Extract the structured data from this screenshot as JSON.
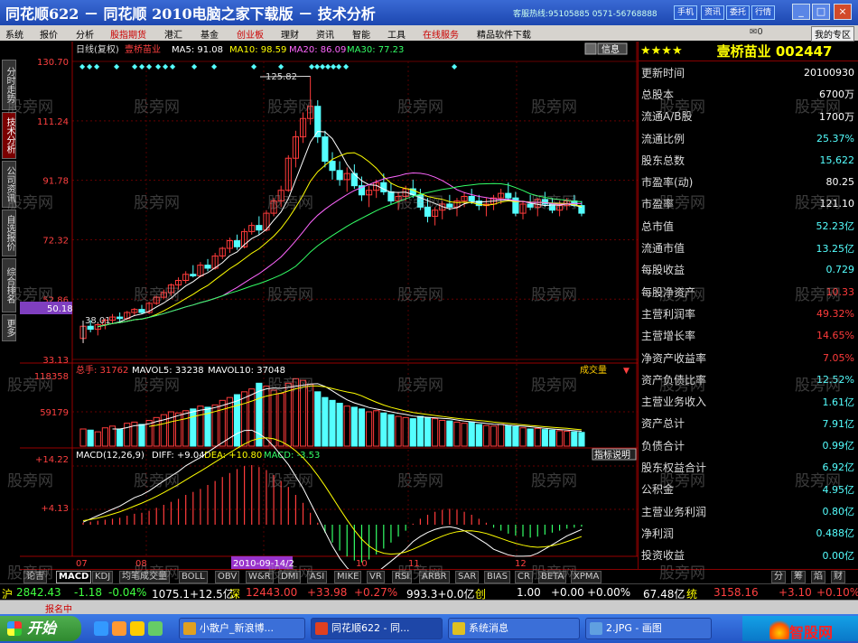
{
  "window": {
    "title": "同花顺622 － 同花顺 2010电脑之家下载版 － 技术分析",
    "hotline": "客服热线:95105885 0571-56768888",
    "title_buttons": [
      "手机",
      "资讯",
      "委托",
      "行情"
    ],
    "mail_count": "0"
  },
  "menu": {
    "items": [
      "系统",
      "报价",
      "分析",
      "股指期货",
      "港汇",
      "基金",
      "创业板",
      "理财",
      "资讯",
      "智能",
      "工具",
      "在线服务",
      "精品软件下载"
    ],
    "highlighted": [
      "股指期货",
      "创业板",
      "在线服务"
    ],
    "my_zone": "我的专区"
  },
  "left_tabs": [
    "分时走势",
    "技术分析",
    "公司资讯",
    "自选报价",
    "综合排名",
    "更多"
  ],
  "chart_header": {
    "period": "日线(复权)",
    "stock_name": "壹桥苗业",
    "ma5": "MA5: 91.08",
    "ma10": "MA10: 98.59",
    "ma20": "MA20: 86.09",
    "ma30": "MA30: 77.23",
    "info_button": "信息",
    "info_icon": "dual-arrow"
  },
  "volume_header": {
    "total": "总手: 31762",
    "mavol5": "MAVOL5: 33238",
    "mavol10": "MAVOL10: 37048",
    "selector": "成交量"
  },
  "macd_header": {
    "title": "MACD(12,26,9)",
    "diff": "DIFF: +9.04",
    "dea": "DEA: +10.80",
    "macd": "MACD: -3.53",
    "help": "指标说明"
  },
  "y_axis": {
    "price_ticks": [
      "130.70",
      "111.24",
      "91.78",
      "72.32",
      "52.86",
      "33.13"
    ],
    "current_price_box": "50.18",
    "volume_ticks": [
      "118358",
      "59179"
    ],
    "macd_ticks": [
      "+14.22",
      "+4.13"
    ]
  },
  "x_axis": {
    "labels": [
      "07",
      "08",
      "10",
      "11",
      "12"
    ],
    "cursor_date": "2010-09-14/2"
  },
  "chart_data": {
    "type": "candlestick",
    "annotations": {
      "high_label": "125.82",
      "low_label": "38.01"
    },
    "price_range": [
      33.13,
      130.7
    ],
    "candles": [
      [
        40,
        45,
        38.5,
        44
      ],
      [
        44,
        46,
        42,
        43
      ],
      [
        43,
        45,
        41,
        44.5
      ],
      [
        44.5,
        46.5,
        43,
        46
      ],
      [
        46,
        48,
        45,
        47
      ],
      [
        47,
        48.5,
        45.5,
        46.5
      ],
      [
        46.5,
        49,
        46,
        48.5
      ],
      [
        48.5,
        50,
        47.5,
        49.5
      ],
      [
        49.5,
        51,
        48,
        48.5
      ],
      [
        48.5,
        52,
        48,
        51.5
      ],
      [
        51.5,
        54,
        51,
        53.5
      ],
      [
        53.5,
        56,
        53,
        55
      ],
      [
        55,
        58,
        54,
        57.5
      ],
      [
        57.5,
        60,
        56,
        59
      ],
      [
        59,
        62,
        58,
        61
      ],
      [
        61,
        64,
        60,
        60.5
      ],
      [
        60.5,
        65,
        60,
        64
      ],
      [
        64,
        66,
        62,
        63
      ],
      [
        63,
        68,
        62.5,
        67
      ],
      [
        67,
        70,
        66,
        69.5
      ],
      [
        69.5,
        73,
        68,
        72
      ],
      [
        72,
        74,
        69,
        70
      ],
      [
        70,
        76,
        69.5,
        75
      ],
      [
        75,
        78,
        74,
        77
      ],
      [
        77,
        80,
        74,
        75.5
      ],
      [
        75.5,
        82,
        75,
        81
      ],
      [
        81,
        86,
        80,
        85
      ],
      [
        85,
        90,
        83,
        88.5
      ],
      [
        88.5,
        100,
        88,
        99
      ],
      [
        99,
        108,
        96,
        106
      ],
      [
        106,
        114,
        104,
        112
      ],
      [
        112,
        125.82,
        110,
        116
      ],
      [
        116,
        118,
        104,
        106
      ],
      [
        106,
        108,
        96,
        98
      ],
      [
        98,
        101,
        92,
        95
      ],
      [
        95,
        98,
        90,
        92
      ],
      [
        92,
        96,
        88,
        94
      ],
      [
        94,
        97,
        89,
        90
      ],
      [
        90,
        93,
        85,
        87
      ],
      [
        87,
        90,
        83,
        88.5
      ],
      [
        88.5,
        92,
        86,
        91
      ],
      [
        91,
        94,
        87,
        88
      ],
      [
        88,
        91,
        84,
        85
      ],
      [
        85,
        88,
        82,
        86.5
      ],
      [
        86.5,
        90,
        85,
        89
      ],
      [
        89,
        92,
        86,
        87
      ],
      [
        87,
        89,
        82,
        83
      ],
      [
        83,
        86,
        78,
        80
      ],
      [
        80,
        83,
        77,
        82
      ],
      [
        82,
        85,
        79,
        84
      ],
      [
        84,
        87,
        82,
        83
      ],
      [
        83,
        86,
        80,
        85
      ],
      [
        85,
        88,
        83,
        86.5
      ],
      [
        86.5,
        89,
        84,
        85
      ],
      [
        85,
        87,
        82,
        83.5
      ],
      [
        83.5,
        86,
        80,
        84
      ],
      [
        84,
        87,
        82,
        86
      ],
      [
        86,
        89,
        84,
        87.5
      ],
      [
        87.5,
        91,
        85,
        86
      ],
      [
        86,
        88,
        80,
        81
      ],
      [
        81,
        85,
        79,
        84
      ],
      [
        84,
        87,
        82,
        83
      ],
      [
        83,
        86,
        80,
        85.5
      ],
      [
        85.5,
        88,
        83,
        84
      ],
      [
        84,
        86,
        81,
        82
      ],
      [
        82,
        85,
        80,
        83.5
      ],
      [
        83.5,
        86,
        82,
        85
      ],
      [
        85,
        87,
        83,
        83.5
      ],
      [
        83.5,
        85,
        80,
        81
      ]
    ],
    "volumes": [
      30,
      28,
      25,
      32,
      35,
      30,
      40,
      42,
      38,
      45,
      50,
      55,
      60,
      58,
      62,
      65,
      70,
      68,
      72,
      80,
      85,
      90,
      95,
      100,
      110,
      105,
      98,
      92,
      110,
      118,
      115,
      108,
      95,
      85,
      80,
      75,
      70,
      68,
      65,
      60,
      62,
      58,
      55,
      52,
      50,
      48,
      52,
      50,
      48,
      45,
      44,
      42,
      40,
      42,
      38,
      36,
      35,
      38,
      36,
      34,
      32,
      30,
      31,
      29,
      28,
      27,
      26,
      25,
      24
    ],
    "ma_series": [
      {
        "name": "MA5",
        "color": "#ffffff"
      },
      {
        "name": "MA10",
        "color": "#ffff00"
      },
      {
        "name": "MA20",
        "color": "#ff66ff"
      },
      {
        "name": "MA30",
        "color": "#33ff66"
      }
    ],
    "macd_histogram": [
      0.2,
      0.3,
      0.4,
      0.5,
      0.6,
      0.7,
      0.9,
      1.1,
      1.2,
      1.4,
      1.7,
      2.0,
      2.3,
      2.6,
      3.0,
      3.3,
      3.6,
      4.0,
      4.4,
      4.8,
      5.2,
      5.6,
      5.9,
      6.0,
      5.8,
      5.5,
      5.0,
      4.4,
      3.8,
      3.0,
      2.2,
      1.2,
      0.2,
      -0.8,
      -1.8,
      -2.6,
      -3.2,
      -3.6,
      -3.8,
      -3.5,
      -3.0,
      -2.4,
      -1.8,
      -1.2,
      -0.6,
      0.1,
      0.6,
      1.0,
      1.3,
      1.5,
      1.6,
      1.5,
      1.3,
      1.0,
      0.6,
      0.2,
      -0.3,
      -0.6,
      -0.9,
      -1.1,
      -1.2,
      -1.3,
      -1.2,
      -1.0,
      -0.8,
      -0.6,
      -0.4,
      -0.3,
      -0.2
    ]
  },
  "fundamentals": {
    "stars": "★★★★",
    "name_code": "壹桥苗业 002447",
    "rows": [
      {
        "label": "更新时间",
        "value": "20100930",
        "color": "white"
      },
      {
        "label": "总股本",
        "value": "6700万",
        "color": "white"
      },
      {
        "label": "流通A/B股",
        "value": "1700万",
        "color": "white"
      },
      {
        "label": "流通比例",
        "value": "25.37%",
        "color": "cyan"
      },
      {
        "label": "股东总数",
        "value": "15,622",
        "color": "cyan"
      },
      {
        "label": "市盈率(动)",
        "value": "80.25",
        "color": "white"
      },
      {
        "label": "市盈率",
        "value": "121.10",
        "color": "white"
      },
      {
        "label": "总市值",
        "value": "52.23亿",
        "color": "cyan"
      },
      {
        "label": "流通市值",
        "value": "13.25亿",
        "color": "cyan"
      },
      {
        "label": "每股收益",
        "value": "0.729",
        "color": "cyan"
      },
      {
        "label": "每股净资产",
        "value": "10.33",
        "color": "red"
      },
      {
        "label": "主营利润率",
        "value": "49.32%",
        "color": "red"
      },
      {
        "label": "主营增长率",
        "value": "14.65%",
        "color": "red"
      },
      {
        "label": "净资产收益率",
        "value": "7.05%",
        "color": "red"
      },
      {
        "label": "资产负债比率",
        "value": "12.52%",
        "color": "cyan"
      },
      {
        "label": "主营业务收入",
        "value": "1.61亿",
        "color": "cyan"
      },
      {
        "label": "资产总计",
        "value": "7.91亿",
        "color": "cyan"
      },
      {
        "label": "负债合计",
        "value": "0.99亿",
        "color": "cyan"
      },
      {
        "label": "股东权益合计",
        "value": "6.92亿",
        "color": "cyan"
      },
      {
        "label": "公积金",
        "value": "4.95亿",
        "color": "cyan"
      },
      {
        "label": "主营业务利润",
        "value": "0.80亿",
        "color": "cyan"
      },
      {
        "label": "净利润",
        "value": "0.488亿",
        "color": "cyan"
      },
      {
        "label": "投资收益",
        "value": "0.00亿",
        "color": "cyan"
      }
    ]
  },
  "indicator_tabs": [
    "论吉",
    "MACD",
    "KDJ",
    "均笔成交量",
    "BOLL",
    "OBV",
    "W&R",
    "DMI",
    "ASI",
    "MIKE",
    "VR",
    "RSI",
    "ARBR",
    "SAR",
    "BIAS",
    "CR",
    "BETA",
    "XPMA"
  ],
  "right_tabs": [
    "分",
    "筹",
    "焰",
    "财"
  ],
  "ticker": {
    "sh_label": "沪",
    "sh_index": "2842.43",
    "sh_change": "-1.18",
    "sh_pct": "-0.04%",
    "sh_amount": "1075.1+12.5亿",
    "sz_label": "深",
    "sz_index": "12443.00",
    "sz_change": "+33.98",
    "sz_pct": "+0.27%",
    "sz_amount": "993.3+0.0亿",
    "cy_label": "创",
    "cy_index": "1.00",
    "cy_change": "+0.00",
    "cy_pct": "+0.00%",
    "unit_label": "67.48亿",
    "tong_label": "统",
    "tong_index": "3158.16",
    "tong_change": "+3.10",
    "tong_pct": "+0.10%"
  },
  "status": {
    "left": "报名中"
  },
  "taskbar": {
    "start": "开始",
    "tasks": [
      {
        "label": "小散户_新浪博...",
        "color": "#e0a020"
      },
      {
        "label": "同花顺622 - 同...",
        "color": "#e04020"
      },
      {
        "label": "系统消息",
        "color": "#e0c020"
      },
      {
        "label": "2.JPG - 画图",
        "color": "#60a0e0"
      }
    ],
    "watermark": "智股网"
  },
  "watermark_text": "股旁网"
}
